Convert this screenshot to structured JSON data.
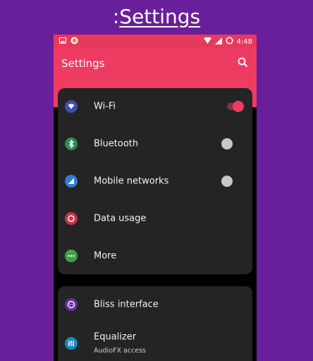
{
  "banner": {
    "prefix": ":",
    "title": "Settings"
  },
  "status_bar": {
    "time": "4:48",
    "icons": [
      "image-icon",
      "app-notification-icon",
      "wifi-signal-icon",
      "cell-signal-icon",
      "battery-ring-icon"
    ]
  },
  "appbar": {
    "title": "Settings",
    "search_icon": "search-icon"
  },
  "colors": {
    "background": "#6a1f9a",
    "accent": "#ee3b61",
    "card": "#242424",
    "wifi_icon": "#3d4fa8",
    "bluetooth_icon": "#2e8b57",
    "mobile_icon": "#2f7fd6",
    "data_icon": "#c7344a",
    "more_icon": "#43a047",
    "bliss_icon": "#6a2ca0",
    "equalizer_icon": "#1e88b8"
  },
  "sections": [
    {
      "items": [
        {
          "label": "Wi-Fi",
          "icon": "wifi-icon",
          "toggle": "on"
        },
        {
          "label": "Bluetooth",
          "icon": "bluetooth-icon",
          "toggle": "off"
        },
        {
          "label": "Mobile networks",
          "icon": "mobile-network-icon",
          "toggle": "off"
        },
        {
          "label": "Data usage",
          "icon": "data-usage-icon"
        },
        {
          "label": "More",
          "icon": "more-icon"
        }
      ]
    },
    {
      "items": [
        {
          "label": "Bliss interface",
          "icon": "bliss-icon"
        },
        {
          "label": "Equalizer",
          "subtitle": "AudioFX access",
          "icon": "equalizer-icon"
        }
      ]
    }
  ]
}
